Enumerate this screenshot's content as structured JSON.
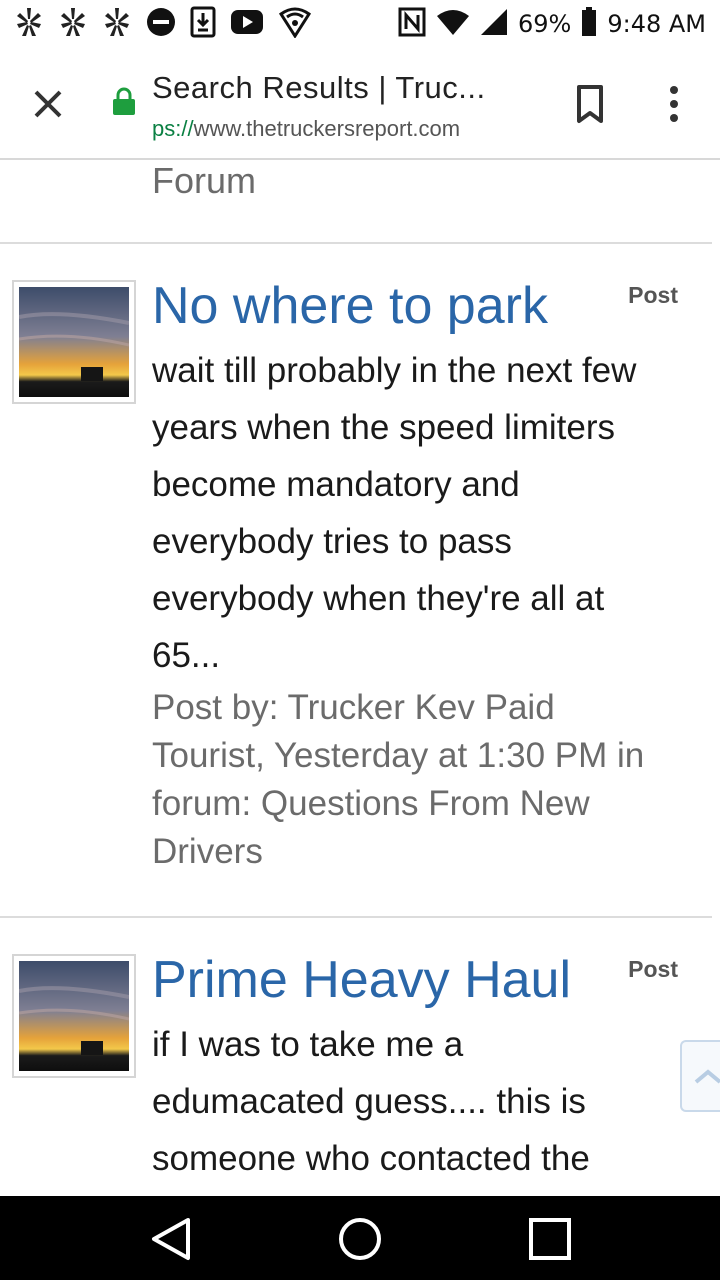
{
  "status_bar": {
    "icons": [
      "yelp-icon",
      "yelp-icon",
      "yelp-icon",
      "do-not-disturb-icon",
      "download-icon",
      "youtube-icon",
      "vpn-shield-icon",
      "nfc-icon",
      "wifi-icon",
      "signal-icon",
      "battery-icon"
    ],
    "battery": "69%",
    "time": "9:48 AM"
  },
  "toolbar": {
    "title": "Search Results | Truc...",
    "url_scheme": "ps://",
    "url_host": "www.thetruckersreport.com",
    "icons": [
      "close-icon",
      "lock-icon",
      "bookmark-icon",
      "more-vert-icon"
    ],
    "accent_color": "#1e9e3e"
  },
  "content": {
    "previous_tail": "Forum",
    "results": [
      {
        "title": "No where to park",
        "type": "Post",
        "snippet_lines": [
          "wait till probably in the next few",
          "years when the speed limiters",
          "become mandatory and",
          "everybody tries to pass",
          "everybody when they're all at",
          "65..."
        ],
        "meta_lines": [
          "Post by: Trucker Kev Paid",
          "Tourist, Yesterday at 1:30 PM in",
          "forum: Questions From New",
          "Drivers"
        ]
      },
      {
        "title": "Prime Heavy Haul",
        "type": "Post",
        "snippet_lines": [
          "if I was to take me a",
          "edumacated guess.... this is",
          "someone who contacted the"
        ]
      }
    ],
    "link_color": "#2a66a8"
  },
  "nav_bar": {
    "icons": [
      "back-icon",
      "home-icon",
      "recents-icon"
    ]
  }
}
